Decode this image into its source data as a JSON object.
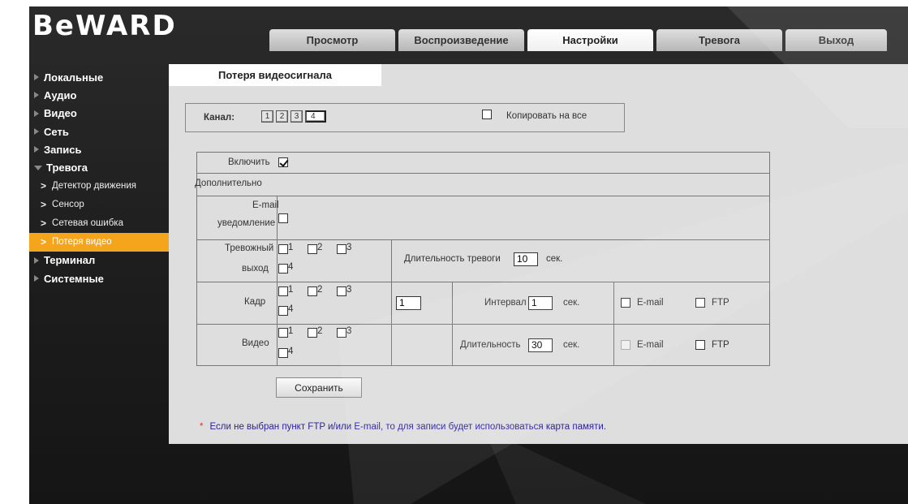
{
  "header": {
    "logo": "BeWARD",
    "tabs": [
      "Просмотр",
      "Воспроизведение",
      "Настройки",
      "Тревога",
      "Выход"
    ],
    "active_tab": "Настройки"
  },
  "sidebar": {
    "items": [
      {
        "label": "Локальные"
      },
      {
        "label": "Аудио"
      },
      {
        "label": "Видео"
      },
      {
        "label": "Сеть"
      },
      {
        "label": "Запись"
      },
      {
        "label": "Тревога"
      },
      {
        "label": "Терминал"
      },
      {
        "label": "Системные"
      }
    ],
    "subitems": [
      {
        "label": "Детектор движения"
      },
      {
        "label": "Сенсор"
      },
      {
        "label": "Сетевая ошибка"
      },
      {
        "label": "Потеря видео"
      }
    ]
  },
  "page": {
    "title": "Потеря видеосигнала",
    "channel_label": "Канал:",
    "channels": [
      "1",
      "2",
      "3",
      "4"
    ],
    "selected_channel": "4",
    "copy_all_label": "Копировать на все",
    "copy_all_checked": false
  },
  "form": {
    "enable_label": "Включить",
    "enable_checked": true,
    "advanced_label": "Дополнительно",
    "email_label_1": "E-mail",
    "email_label_2": "уведомление",
    "email_checked": false,
    "alarm_out_label_1": "Тревожный",
    "alarm_out_label_2": "выход",
    "outputs": [
      "1",
      "2",
      "3",
      "4"
    ],
    "alarm_duration_label": "Длительность тревоги",
    "alarm_duration_value": "10",
    "sec": "сек.",
    "frame_label": "Кадр",
    "frame_count_value": "1",
    "interval_label": "Интервал",
    "interval_value": "1",
    "video_label": "Видео",
    "duration_label": "Длительность",
    "duration_value": "30",
    "email_opt": "E-mail",
    "ftp_opt": "FTP"
  },
  "save_label": "Сохранить",
  "note": {
    "star": "*",
    "text": "Если не выбран пункт FTP и/или E-mail, то для записи будет использоваться карта памяти."
  },
  "colors": {
    "accent": "#f5a51c",
    "background": "#1c1c1c",
    "panel": "#dedede",
    "note": "#2b1f9e"
  }
}
